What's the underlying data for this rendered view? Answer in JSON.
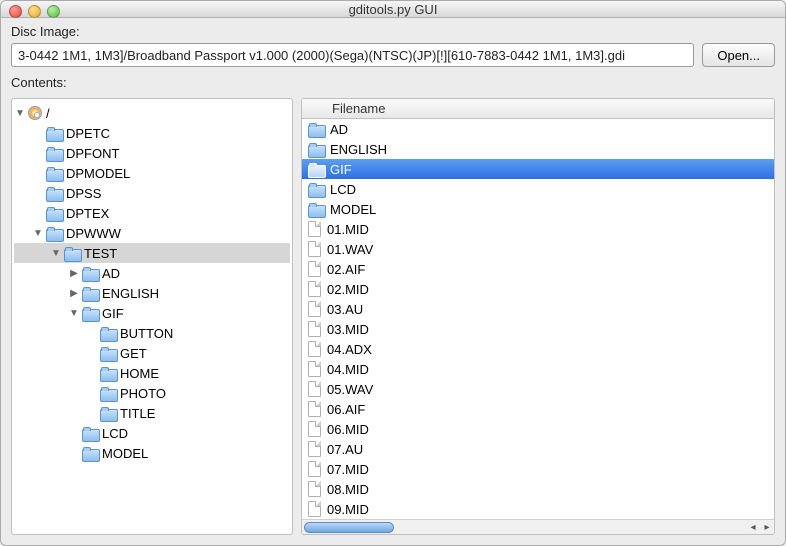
{
  "window": {
    "title": "gditools.py GUI"
  },
  "disc_image": {
    "label": "Disc Image:",
    "path": "3-0442 1M1, 1M3]/Broadband Passport v1.000 (2000)(Sega)(NTSC)(JP)[!][610-7883-0442 1M1, 1M3].gdi",
    "open_label": "Open..."
  },
  "contents": {
    "label": "Contents:",
    "root": "/",
    "tree": [
      {
        "name": "DPETC",
        "depth": 1,
        "disclosure": "none"
      },
      {
        "name": "DPFONT",
        "depth": 1,
        "disclosure": "none"
      },
      {
        "name": "DPMODEL",
        "depth": 1,
        "disclosure": "none"
      },
      {
        "name": "DPSS",
        "depth": 1,
        "disclosure": "none"
      },
      {
        "name": "DPTEX",
        "depth": 1,
        "disclosure": "none"
      },
      {
        "name": "DPWWW",
        "depth": 1,
        "disclosure": "open"
      },
      {
        "name": "TEST",
        "depth": 2,
        "disclosure": "open",
        "selected": true
      },
      {
        "name": "AD",
        "depth": 3,
        "disclosure": "closed"
      },
      {
        "name": "ENGLISH",
        "depth": 3,
        "disclosure": "closed"
      },
      {
        "name": "GIF",
        "depth": 3,
        "disclosure": "open"
      },
      {
        "name": "BUTTON",
        "depth": 4,
        "disclosure": "none"
      },
      {
        "name": "GET",
        "depth": 4,
        "disclosure": "none"
      },
      {
        "name": "HOME",
        "depth": 4,
        "disclosure": "none"
      },
      {
        "name": "PHOTO",
        "depth": 4,
        "disclosure": "none"
      },
      {
        "name": "TITLE",
        "depth": 4,
        "disclosure": "none"
      },
      {
        "name": "LCD",
        "depth": 3,
        "disclosure": "none"
      },
      {
        "name": "MODEL",
        "depth": 3,
        "disclosure": "none"
      }
    ]
  },
  "filelist": {
    "header": "Filename",
    "rows": [
      {
        "name": "AD",
        "type": "folder"
      },
      {
        "name": "ENGLISH",
        "type": "folder"
      },
      {
        "name": "GIF",
        "type": "folder",
        "selected": true
      },
      {
        "name": "LCD",
        "type": "folder"
      },
      {
        "name": "MODEL",
        "type": "folder"
      },
      {
        "name": "01.MID",
        "type": "file"
      },
      {
        "name": "01.WAV",
        "type": "file"
      },
      {
        "name": "02.AIF",
        "type": "file"
      },
      {
        "name": "02.MID",
        "type": "file"
      },
      {
        "name": "03.AU",
        "type": "file"
      },
      {
        "name": "03.MID",
        "type": "file"
      },
      {
        "name": "04.ADX",
        "type": "file"
      },
      {
        "name": "04.MID",
        "type": "file"
      },
      {
        "name": "05.WAV",
        "type": "file"
      },
      {
        "name": "06.AIF",
        "type": "file"
      },
      {
        "name": "06.MID",
        "type": "file"
      },
      {
        "name": "07.AU",
        "type": "file"
      },
      {
        "name": "07.MID",
        "type": "file"
      },
      {
        "name": "08.MID",
        "type": "file"
      },
      {
        "name": "09.MID",
        "type": "file"
      }
    ]
  }
}
